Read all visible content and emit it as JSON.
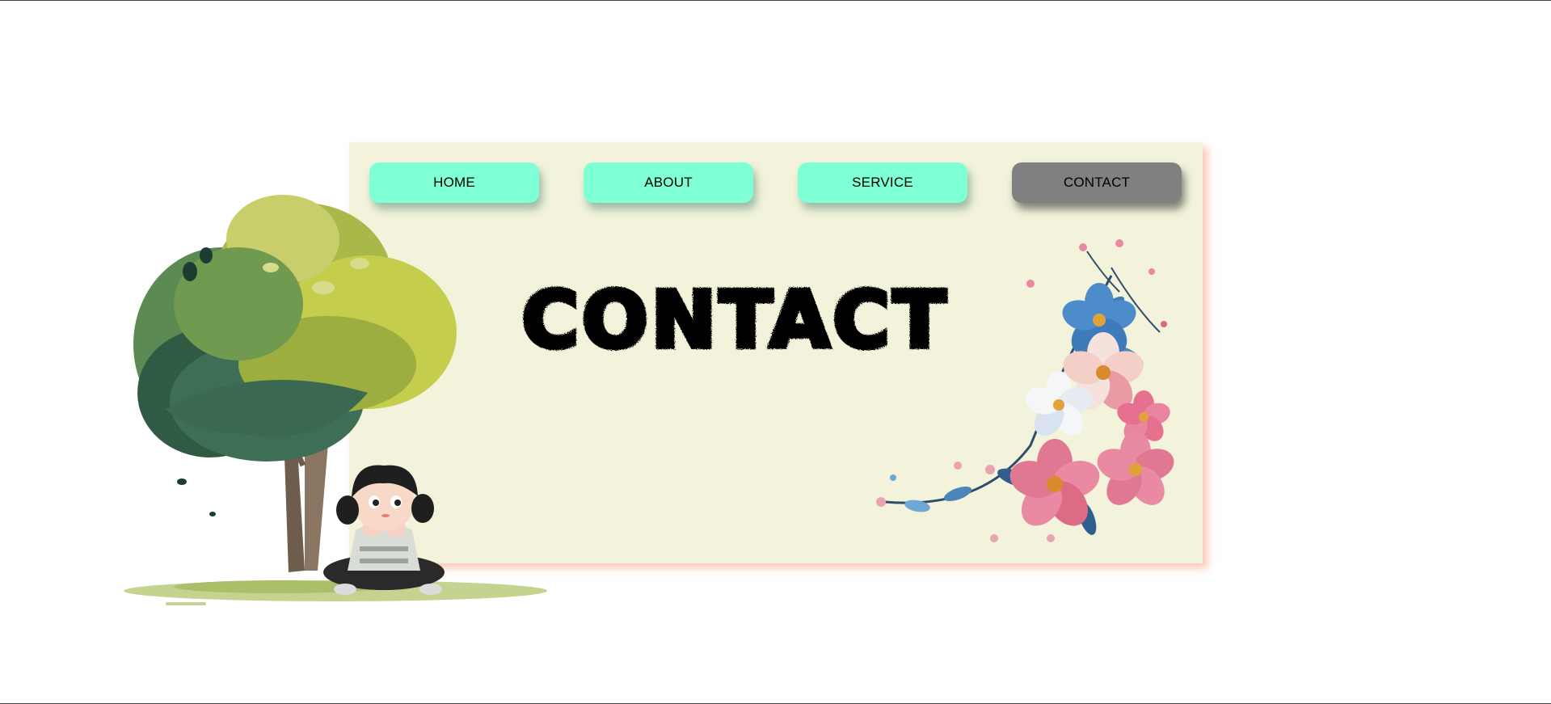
{
  "nav": {
    "items": [
      {
        "label": "HOME",
        "active": false
      },
      {
        "label": "ABOUT",
        "active": false
      },
      {
        "label": "SERVICE",
        "active": false
      },
      {
        "label": "CONTACT",
        "active": true
      }
    ]
  },
  "main": {
    "heading": "CONTACT"
  },
  "images": {
    "tree_illustration": "tree-with-girl-illustration",
    "flower_illustration": "floral-corner-illustration"
  },
  "colors": {
    "card_background": "#f2f3da",
    "nav_button": "#7fffd4",
    "nav_button_active": "#808080",
    "card_shadow": "#f59678"
  }
}
